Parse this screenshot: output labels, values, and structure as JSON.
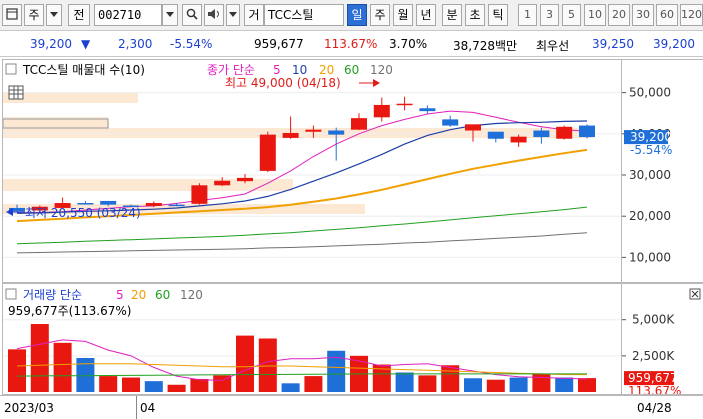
{
  "toolbar": {
    "market_label": "주",
    "jeon_label": "전",
    "code_value": "002710",
    "gubun_label": "거",
    "stock_name": "TCC스틸",
    "periods": [
      "일",
      "주",
      "월",
      "년",
      "분",
      "초",
      "틱"
    ],
    "active_period": "일",
    "intervals": [
      "1",
      "3",
      "5",
      "10",
      "20",
      "30",
      "60",
      "120"
    ]
  },
  "quote": {
    "price": "39,200",
    "change_arrow": "▼",
    "change": "2,300",
    "change_pct": "-5.54%",
    "volume": "959,677",
    "volume_ratio": "113.67%",
    "turnover": "3.70%",
    "amount": "38,728백만",
    "best_label": "최우선",
    "ask": "39,250",
    "bid": "39,200"
  },
  "price_panel": {
    "title": "TCC스틸 매물대 수(10)",
    "ma_prefix": "종가 단순",
    "ma_periods": [
      "5",
      "10",
      "20",
      "60",
      "120"
    ],
    "high_label": "최고 49,000 (04/18)",
    "low_label": "최저 20,550 (03/24)",
    "y_ticks": [
      "50,000",
      "40,000",
      "30,000",
      "20,000",
      "10,000"
    ],
    "last_price_tag": "39,200",
    "last_change_tag": "-5.54%"
  },
  "volume_panel": {
    "title_prefix": "거래량 단순",
    "ma_periods": [
      "5",
      "20",
      "60",
      "120"
    ],
    "volume_label": "959,677주(113.67%)",
    "y_ticks": [
      "5,000K",
      "2,500K"
    ],
    "last_volume_tag": "959,677",
    "last_ratio_tag": "113.67%"
  },
  "x_axis": {
    "labels": [
      "2023/03",
      "04"
    ],
    "right_date": "04/28"
  },
  "colors": {
    "up": "#e8170f",
    "down": "#1f6fd8",
    "ma5": "#e020c0",
    "ma10": "#1c3fa8",
    "ma20": "#f0a000",
    "ma60": "#20a020",
    "ma120": "#707070"
  },
  "chart_data": {
    "type": "candlestick",
    "x_labels": [
      "2023/03",
      "04"
    ],
    "price_axis_range": [
      5000,
      55000
    ],
    "candles": [
      {
        "o": 22000,
        "h": 22800,
        "c": 21200,
        "l": 20900
      },
      {
        "o": 21400,
        "h": 22600,
        "c": 22300,
        "l": 21100
      },
      {
        "o": 22000,
        "h": 24500,
        "c": 23200,
        "l": 21900
      },
      {
        "o": 23200,
        "h": 23700,
        "c": 23000,
        "l": 22800
      },
      {
        "o": 23700,
        "h": 23700,
        "c": 22800,
        "l": 22400
      },
      {
        "o": 22600,
        "h": 22800,
        "c": 22400,
        "l": 22300
      },
      {
        "o": 22500,
        "h": 23600,
        "c": 23200,
        "l": 22200
      },
      {
        "o": 22800,
        "h": 23200,
        "c": 22500,
        "l": 22400
      },
      {
        "o": 23000,
        "h": 28000,
        "c": 27500,
        "l": 22800
      },
      {
        "o": 27500,
        "h": 29500,
        "c": 28600,
        "l": 27300
      },
      {
        "o": 28500,
        "h": 30200,
        "c": 29300,
        "l": 28000
      },
      {
        "o": 31000,
        "h": 40500,
        "c": 39800,
        "l": 30700
      },
      {
        "o": 39000,
        "h": 44200,
        "c": 40200,
        "l": 38800
      },
      {
        "o": 40500,
        "h": 42000,
        "c": 41000,
        "l": 39000
      },
      {
        "o": 40800,
        "h": 41500,
        "c": 39800,
        "l": 33500
      },
      {
        "o": 41000,
        "h": 45000,
        "c": 43800,
        "l": 40900
      },
      {
        "o": 44000,
        "h": 48800,
        "c": 47000,
        "l": 43000
      },
      {
        "o": 47300,
        "h": 49000,
        "c": 47300,
        "l": 45700
      },
      {
        "o": 46200,
        "h": 46900,
        "c": 45500,
        "l": 44800
      },
      {
        "o": 43500,
        "h": 44400,
        "c": 42000,
        "l": 41700
      },
      {
        "o": 40800,
        "h": 41300,
        "c": 42300,
        "l": 38100
      },
      {
        "o": 40500,
        "h": 40500,
        "c": 38800,
        "l": 37900
      },
      {
        "o": 37900,
        "h": 39800,
        "c": 39300,
        "l": 36800
      },
      {
        "o": 40800,
        "h": 41500,
        "c": 39200,
        "l": 37600
      },
      {
        "o": 38800,
        "h": 42000,
        "c": 41700,
        "l": 38600
      },
      {
        "o": 42000,
        "h": 42300,
        "c": 39200,
        "l": 38900
      }
    ],
    "ma_series": [
      {
        "period": "5",
        "values": [
          20800,
          20900,
          21100,
          21500,
          21900,
          22300,
          22500,
          23100,
          23800,
          24500,
          25400,
          28000,
          31000,
          34500,
          37500,
          40000,
          42000,
          43500,
          44800,
          45500,
          45200,
          44000,
          42800,
          41700,
          41000,
          40600
        ]
      },
      {
        "period": "10",
        "values": [
          20700,
          20800,
          21000,
          21200,
          21300,
          21500,
          21700,
          22000,
          22500,
          23000,
          23700,
          24800,
          26500,
          28500,
          30500,
          32700,
          35000,
          37500,
          39600,
          41000,
          42000,
          42500,
          42700,
          42800,
          43000,
          43100
        ]
      },
      {
        "period": "20",
        "values": [
          18800,
          19100,
          19400,
          19700,
          20000,
          20300,
          20600,
          20900,
          21200,
          21500,
          21800,
          22200,
          22800,
          23500,
          24300,
          25300,
          26400,
          27700,
          29000,
          30300,
          31500,
          32500,
          33500,
          34400,
          35300,
          36100
        ]
      },
      {
        "period": "60",
        "values": [
          13300,
          13500,
          13700,
          13900,
          14100,
          14300,
          14500,
          14700,
          14900,
          15100,
          15400,
          15700,
          16000,
          16400,
          16800,
          17200,
          17700,
          18100,
          18600,
          19100,
          19600,
          20100,
          20600,
          21100,
          21600,
          22200
        ]
      },
      {
        "period": "120",
        "values": [
          11100,
          11200,
          11300,
          11400,
          11500,
          11600,
          11700,
          11800,
          11900,
          12000,
          12100,
          12300,
          12400,
          12600,
          12800,
          13000,
          13200,
          13500,
          13700,
          14000,
          14300,
          14600,
          14900,
          15200,
          15600,
          16000
        ]
      }
    ],
    "volume_axis_range": [
      0,
      6500000
    ],
    "volume": [
      2950000,
      4700000,
      3400000,
      2350000,
      1100000,
      1000000,
      750000,
      500000,
      900000,
      1150000,
      3900000,
      3700000,
      600000,
      1100000,
      2850000,
      2500000,
      1900000,
      1350000,
      1150000,
      1850000,
      950000,
      850000,
      1000000,
      1250000,
      1000000,
      959677
    ],
    "volume_up": [
      true,
      true,
      true,
      false,
      true,
      true,
      false,
      true,
      true,
      true,
      true,
      true,
      false,
      true,
      false,
      true,
      true,
      false,
      true,
      true,
      false,
      true,
      false,
      true,
      false,
      true
    ],
    "vol_ma_series": [
      {
        "period": "5",
        "values": [
          3000000,
          3300000,
          3600000,
          3500000,
          2900000,
          2500000,
          1700000,
          1100000,
          850000,
          800000,
          1500000,
          2100000,
          2300000,
          2300000,
          2400000,
          2150000,
          1800000,
          1900000,
          1950000,
          1700000,
          1450000,
          1200000,
          1050000,
          1000000,
          950000,
          900000
        ]
      },
      {
        "period": "20",
        "values": [
          1800000,
          1850000,
          1900000,
          1950000,
          1950000,
          1950000,
          1900000,
          1850000,
          1800000,
          1750000,
          1750000,
          1800000,
          1800000,
          1750000,
          1700000,
          1650000,
          1600000,
          1550000,
          1500000,
          1450000,
          1400000,
          1350000,
          1300000,
          1250000,
          1200000,
          1200000
        ]
      },
      {
        "period": "60",
        "values": [
          1100000,
          1110000,
          1120000,
          1130000,
          1140000,
          1150000,
          1160000,
          1170000,
          1180000,
          1190000,
          1200000,
          1210000,
          1220000,
          1230000,
          1240000,
          1250000,
          1250000,
          1250000,
          1250000,
          1250000,
          1250000,
          1250000,
          1250000,
          1250000,
          1250000,
          1250000
        ]
      }
    ]
  }
}
